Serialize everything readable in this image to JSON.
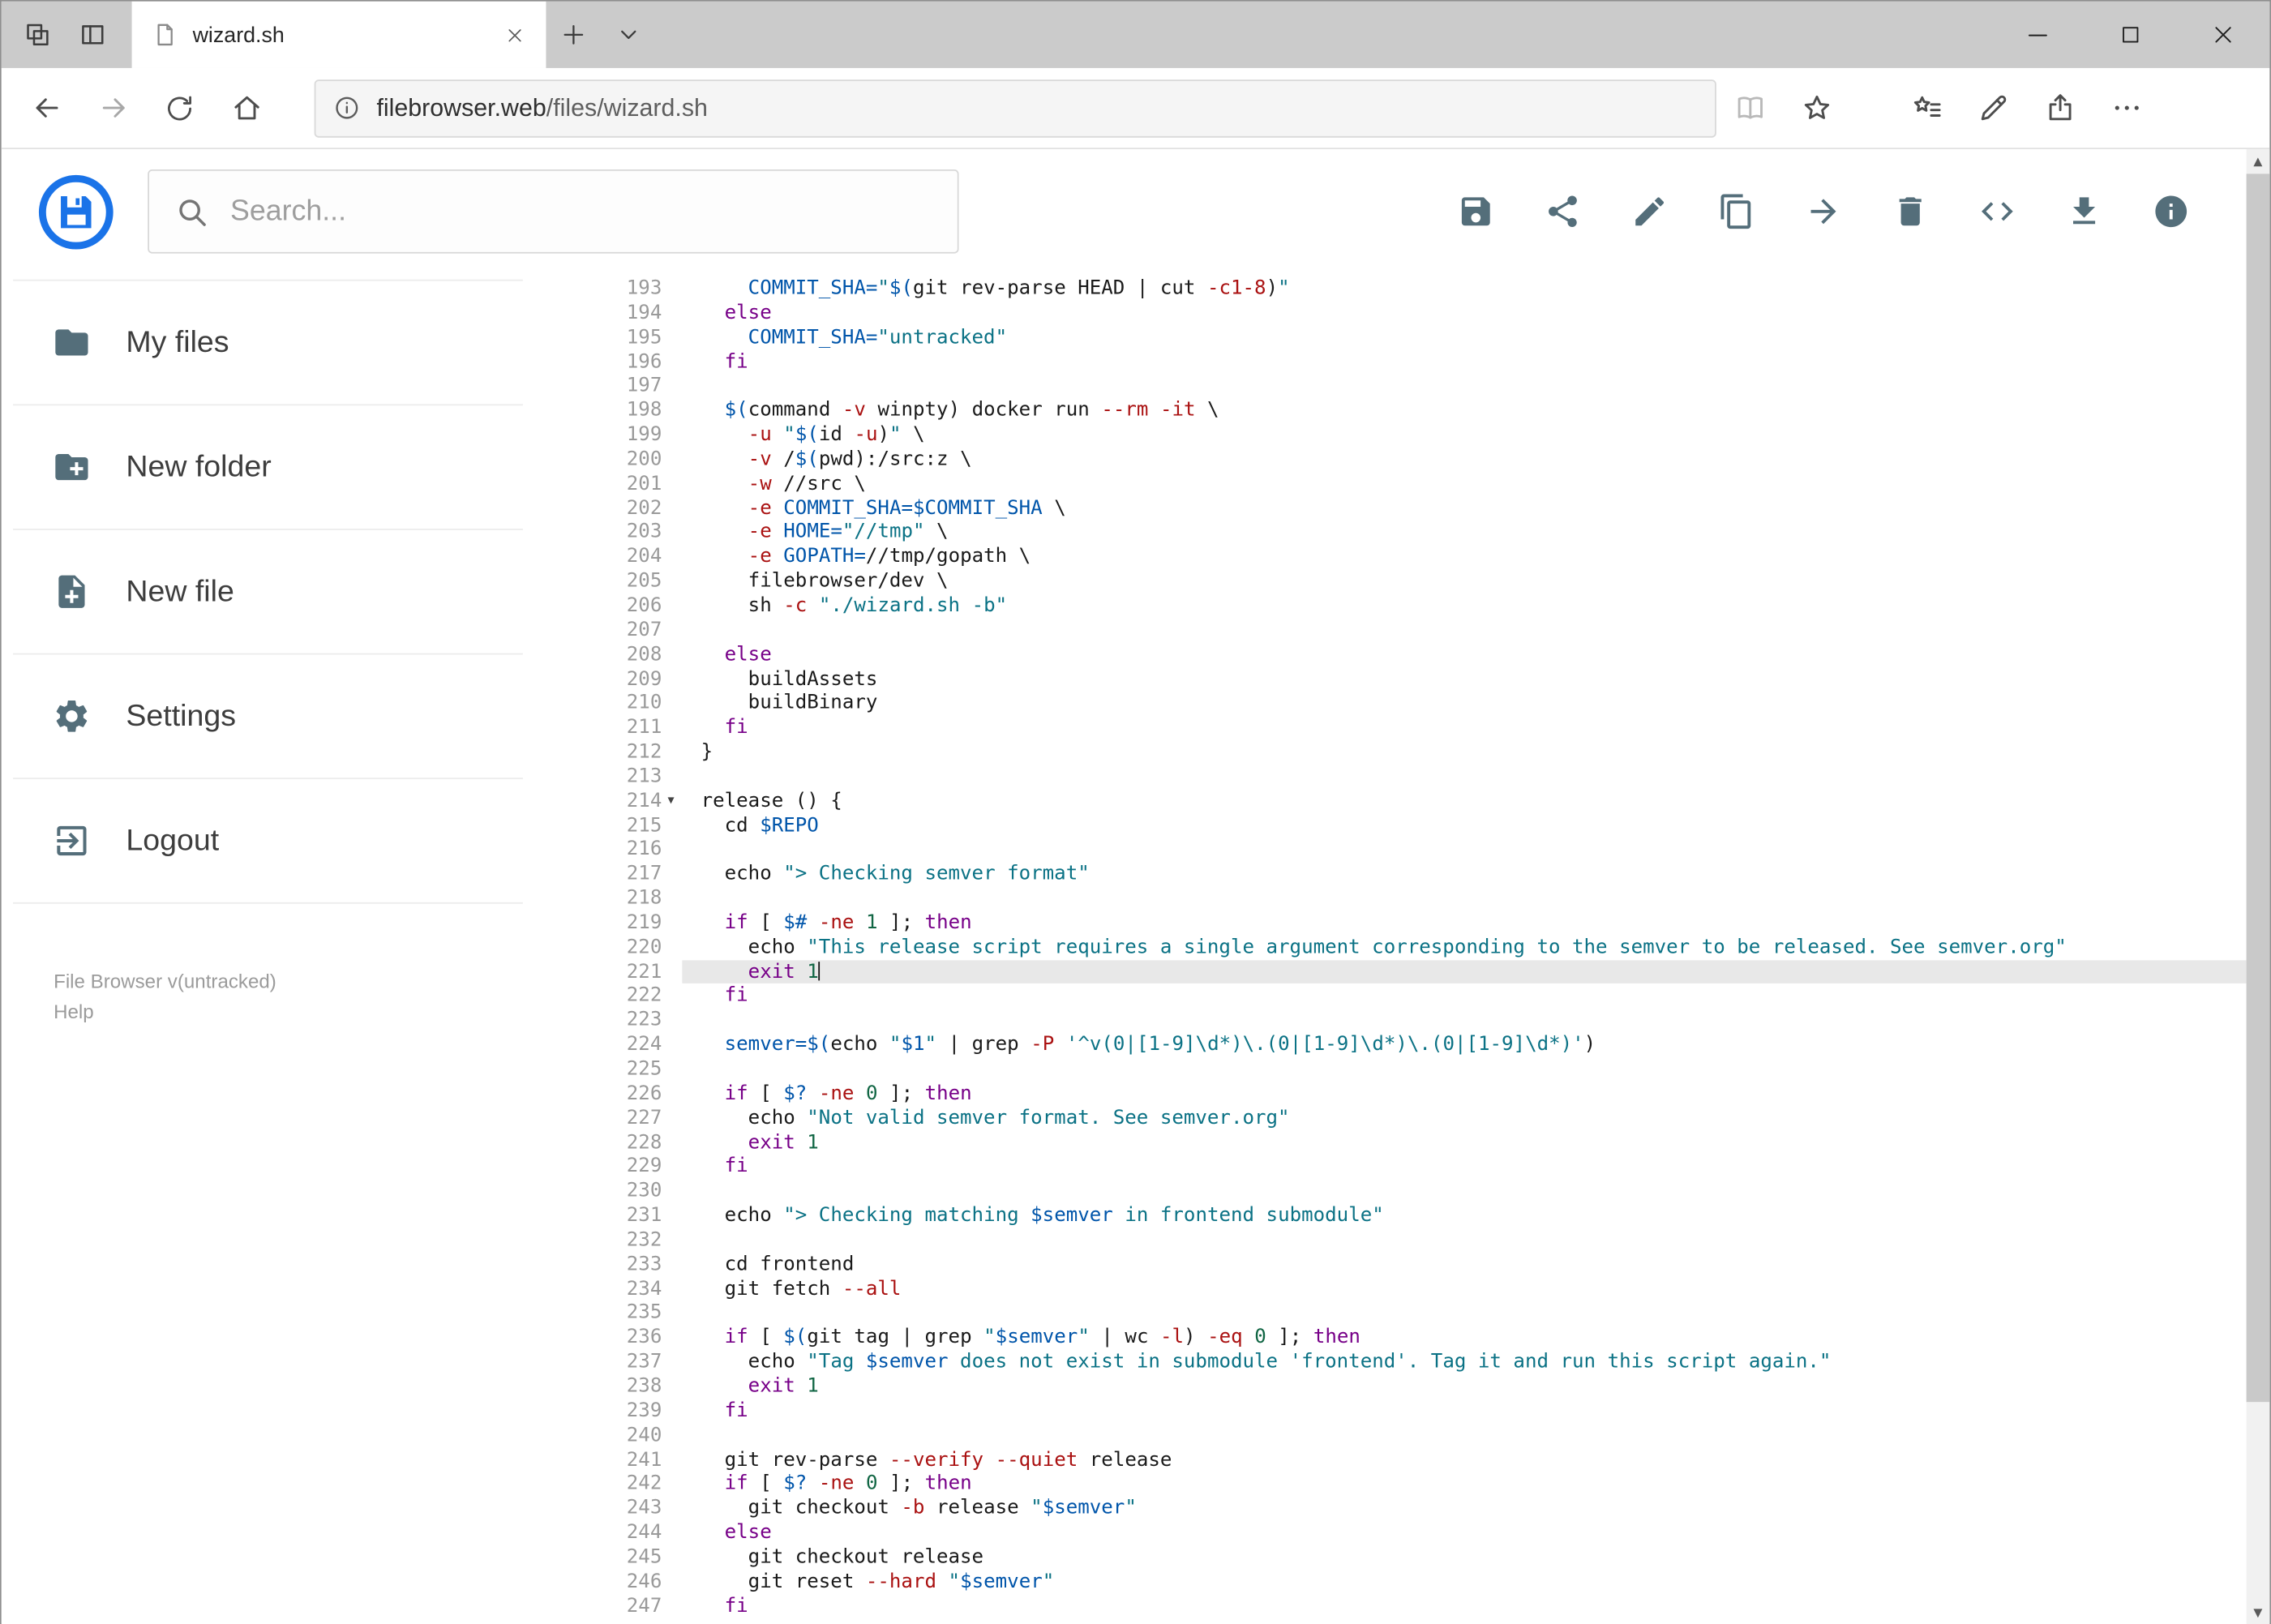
{
  "colors": {
    "accent_blue": "#1a73e8",
    "icon_gray": "#546e7a",
    "active_line_bg": "#e8e8e8",
    "code_keyword": "#770088",
    "code_string": "#0b7285",
    "code_variable": "#0055aa",
    "code_number": "#116644",
    "code_flag": "#aa1111"
  },
  "browser": {
    "tab_title": "wizard.sh",
    "url_domain": "filebrowser.web",
    "url_path": "/files/wizard.sh",
    "url_full": "filebrowser.web/files/wizard.sh"
  },
  "toolbar": {
    "search_placeholder": "Search...",
    "actions": [
      {
        "icon": "save"
      },
      {
        "icon": "share"
      },
      {
        "icon": "edit"
      },
      {
        "icon": "copy"
      },
      {
        "icon": "move"
      },
      {
        "icon": "delete"
      },
      {
        "icon": "code"
      },
      {
        "icon": "download"
      },
      {
        "icon": "info"
      }
    ]
  },
  "sidebar": {
    "items": [
      {
        "icon": "folder",
        "label": "My files"
      },
      {
        "icon": "new-folder",
        "label": "New folder"
      },
      {
        "icon": "new-file",
        "label": "New file"
      },
      {
        "icon": "settings",
        "label": "Settings"
      },
      {
        "icon": "logout",
        "label": "Logout"
      }
    ],
    "footer": {
      "version_label": "File Browser v(untracked)",
      "help_label": "Help"
    }
  },
  "editor": {
    "active_line": 221,
    "lines": [
      {
        "n": 193,
        "t": [
          [
            "pl",
            "    "
          ],
          [
            "vr",
            "COMMIT_SHA="
          ],
          [
            "st",
            "\""
          ],
          [
            "vr",
            "$("
          ],
          [
            "pl",
            "git rev-parse HEAD | cut "
          ],
          [
            "fl",
            "-c1-8"
          ],
          [
            "pl",
            ")"
          ],
          [
            "st",
            "\""
          ]
        ]
      },
      {
        "n": 194,
        "t": [
          [
            "pl",
            "  "
          ],
          [
            "kw",
            "else"
          ]
        ]
      },
      {
        "n": 195,
        "t": [
          [
            "pl",
            "    "
          ],
          [
            "vr",
            "COMMIT_SHA="
          ],
          [
            "st",
            "\"untracked\""
          ]
        ]
      },
      {
        "n": 196,
        "t": [
          [
            "pl",
            "  "
          ],
          [
            "kw",
            "fi"
          ]
        ]
      },
      {
        "n": 197,
        "t": []
      },
      {
        "n": 198,
        "t": [
          [
            "pl",
            "  "
          ],
          [
            "vr",
            "$("
          ],
          [
            "pl",
            "command "
          ],
          [
            "fl",
            "-v"
          ],
          [
            "pl",
            " winpty) docker run "
          ],
          [
            "fl",
            "--rm"
          ],
          [
            "pl",
            " "
          ],
          [
            "fl",
            "-it"
          ],
          [
            "pl",
            " \\"
          ]
        ]
      },
      {
        "n": 199,
        "t": [
          [
            "pl",
            "    "
          ],
          [
            "fl",
            "-u"
          ],
          [
            "pl",
            " "
          ],
          [
            "st",
            "\""
          ],
          [
            "vr",
            "$("
          ],
          [
            "pl",
            "id "
          ],
          [
            "fl",
            "-u"
          ],
          [
            "pl",
            ")"
          ],
          [
            "st",
            "\""
          ],
          [
            "pl",
            " \\"
          ]
        ]
      },
      {
        "n": 200,
        "t": [
          [
            "pl",
            "    "
          ],
          [
            "fl",
            "-v"
          ],
          [
            "pl",
            " /"
          ],
          [
            "vr",
            "$("
          ],
          [
            "pl",
            "pwd):/src:z \\"
          ]
        ]
      },
      {
        "n": 201,
        "t": [
          [
            "pl",
            "    "
          ],
          [
            "fl",
            "-w"
          ],
          [
            "pl",
            " //src \\"
          ]
        ]
      },
      {
        "n": 202,
        "t": [
          [
            "pl",
            "    "
          ],
          [
            "fl",
            "-e"
          ],
          [
            "pl",
            " "
          ],
          [
            "vr",
            "COMMIT_SHA=$COMMIT_SHA"
          ],
          [
            "pl",
            " \\"
          ]
        ]
      },
      {
        "n": 203,
        "t": [
          [
            "pl",
            "    "
          ],
          [
            "fl",
            "-e"
          ],
          [
            "pl",
            " "
          ],
          [
            "vr",
            "HOME="
          ],
          [
            "st",
            "\"//tmp\""
          ],
          [
            "pl",
            " \\"
          ]
        ]
      },
      {
        "n": 204,
        "t": [
          [
            "pl",
            "    "
          ],
          [
            "fl",
            "-e"
          ],
          [
            "pl",
            " "
          ],
          [
            "vr",
            "GOPATH="
          ],
          [
            "pl",
            "//tmp/gopath \\"
          ]
        ]
      },
      {
        "n": 205,
        "t": [
          [
            "pl",
            "    filebrowser/dev \\"
          ]
        ]
      },
      {
        "n": 206,
        "t": [
          [
            "pl",
            "    sh "
          ],
          [
            "fl",
            "-c"
          ],
          [
            "pl",
            " "
          ],
          [
            "st",
            "\"./wizard.sh -b\""
          ]
        ]
      },
      {
        "n": 207,
        "t": []
      },
      {
        "n": 208,
        "t": [
          [
            "pl",
            "  "
          ],
          [
            "kw",
            "else"
          ]
        ]
      },
      {
        "n": 209,
        "t": [
          [
            "pl",
            "    buildAssets"
          ]
        ]
      },
      {
        "n": 210,
        "t": [
          [
            "pl",
            "    buildBinary"
          ]
        ]
      },
      {
        "n": 211,
        "t": [
          [
            "pl",
            "  "
          ],
          [
            "kw",
            "fi"
          ]
        ]
      },
      {
        "n": 212,
        "t": [
          [
            "pl",
            "}"
          ]
        ]
      },
      {
        "n": 213,
        "t": []
      },
      {
        "n": 214,
        "fold": true,
        "t": [
          [
            "pl",
            "release () {"
          ]
        ]
      },
      {
        "n": 215,
        "t": [
          [
            "pl",
            "  cd "
          ],
          [
            "vr",
            "$REPO"
          ]
        ]
      },
      {
        "n": 216,
        "t": []
      },
      {
        "n": 217,
        "t": [
          [
            "pl",
            "  echo "
          ],
          [
            "st",
            "\"> Checking semver format\""
          ]
        ]
      },
      {
        "n": 218,
        "t": []
      },
      {
        "n": 219,
        "t": [
          [
            "pl",
            "  "
          ],
          [
            "kw",
            "if"
          ],
          [
            "pl",
            " [ "
          ],
          [
            "vr",
            "$#"
          ],
          [
            "pl",
            " "
          ],
          [
            "fl",
            "-ne"
          ],
          [
            "pl",
            " "
          ],
          [
            "nm",
            "1"
          ],
          [
            "pl",
            " ]; "
          ],
          [
            "kw",
            "then"
          ]
        ]
      },
      {
        "n": 220,
        "t": [
          [
            "pl",
            "    echo "
          ],
          [
            "st",
            "\"This release script requires a single argument corresponding to the semver to be released. See semver.org\""
          ]
        ]
      },
      {
        "n": 221,
        "active": true,
        "cursor": true,
        "t": [
          [
            "pl",
            "    "
          ],
          [
            "kw",
            "exit"
          ],
          [
            "pl",
            " "
          ],
          [
            "nm",
            "1"
          ]
        ]
      },
      {
        "n": 222,
        "t": [
          [
            "pl",
            "  "
          ],
          [
            "kw",
            "fi"
          ]
        ]
      },
      {
        "n": 223,
        "t": []
      },
      {
        "n": 224,
        "t": [
          [
            "pl",
            "  "
          ],
          [
            "vr",
            "semver=$("
          ],
          [
            "pl",
            "echo "
          ],
          [
            "st",
            "\""
          ],
          [
            "vr",
            "$1"
          ],
          [
            "st",
            "\""
          ],
          [
            "pl",
            " | grep "
          ],
          [
            "fl",
            "-P"
          ],
          [
            "pl",
            " "
          ],
          [
            "st",
            "'^v(0|[1-9]\\d*)\\.(0|[1-9]\\d*)\\.(0|[1-9]\\d*)'"
          ],
          [
            "pl",
            ")"
          ]
        ]
      },
      {
        "n": 225,
        "t": []
      },
      {
        "n": 226,
        "t": [
          [
            "pl",
            "  "
          ],
          [
            "kw",
            "if"
          ],
          [
            "pl",
            " [ "
          ],
          [
            "vr",
            "$?"
          ],
          [
            "pl",
            " "
          ],
          [
            "fl",
            "-ne"
          ],
          [
            "pl",
            " "
          ],
          [
            "nm",
            "0"
          ],
          [
            "pl",
            " ]; "
          ],
          [
            "kw",
            "then"
          ]
        ]
      },
      {
        "n": 227,
        "t": [
          [
            "pl",
            "    echo "
          ],
          [
            "st",
            "\"Not valid semver format. See semver.org\""
          ]
        ]
      },
      {
        "n": 228,
        "t": [
          [
            "pl",
            "    "
          ],
          [
            "kw",
            "exit"
          ],
          [
            "pl",
            " "
          ],
          [
            "nm",
            "1"
          ]
        ]
      },
      {
        "n": 229,
        "t": [
          [
            "pl",
            "  "
          ],
          [
            "kw",
            "fi"
          ]
        ]
      },
      {
        "n": 230,
        "t": []
      },
      {
        "n": 231,
        "t": [
          [
            "pl",
            "  echo "
          ],
          [
            "st",
            "\"> Checking matching "
          ],
          [
            "vr",
            "$semver"
          ],
          [
            "st",
            " in frontend submodule\""
          ]
        ]
      },
      {
        "n": 232,
        "t": []
      },
      {
        "n": 233,
        "t": [
          [
            "pl",
            "  cd frontend"
          ]
        ]
      },
      {
        "n": 234,
        "t": [
          [
            "pl",
            "  git fetch "
          ],
          [
            "fl",
            "--all"
          ]
        ]
      },
      {
        "n": 235,
        "t": []
      },
      {
        "n": 236,
        "t": [
          [
            "pl",
            "  "
          ],
          [
            "kw",
            "if"
          ],
          [
            "pl",
            " [ "
          ],
          [
            "vr",
            "$("
          ],
          [
            "pl",
            "git tag | grep "
          ],
          [
            "st",
            "\""
          ],
          [
            "vr",
            "$semver"
          ],
          [
            "st",
            "\""
          ],
          [
            "pl",
            " | wc "
          ],
          [
            "fl",
            "-l"
          ],
          [
            "pl",
            ") "
          ],
          [
            "fl",
            "-eq"
          ],
          [
            "pl",
            " "
          ],
          [
            "nm",
            "0"
          ],
          [
            "pl",
            " ]; "
          ],
          [
            "kw",
            "then"
          ]
        ]
      },
      {
        "n": 237,
        "t": [
          [
            "pl",
            "    echo "
          ],
          [
            "st",
            "\"Tag "
          ],
          [
            "vr",
            "$semver"
          ],
          [
            "st",
            " does not exist in submodule 'frontend'. Tag it and run this script again.\""
          ]
        ]
      },
      {
        "n": 238,
        "t": [
          [
            "pl",
            "    "
          ],
          [
            "kw",
            "exit"
          ],
          [
            "pl",
            " "
          ],
          [
            "nm",
            "1"
          ]
        ]
      },
      {
        "n": 239,
        "t": [
          [
            "pl",
            "  "
          ],
          [
            "kw",
            "fi"
          ]
        ]
      },
      {
        "n": 240,
        "t": []
      },
      {
        "n": 241,
        "t": [
          [
            "pl",
            "  git rev-parse "
          ],
          [
            "fl",
            "--verify"
          ],
          [
            "pl",
            " "
          ],
          [
            "fl",
            "--quiet"
          ],
          [
            "pl",
            " release"
          ]
        ]
      },
      {
        "n": 242,
        "t": [
          [
            "pl",
            "  "
          ],
          [
            "kw",
            "if"
          ],
          [
            "pl",
            " [ "
          ],
          [
            "vr",
            "$?"
          ],
          [
            "pl",
            " "
          ],
          [
            "fl",
            "-ne"
          ],
          [
            "pl",
            " "
          ],
          [
            "nm",
            "0"
          ],
          [
            "pl",
            " ]; "
          ],
          [
            "kw",
            "then"
          ]
        ]
      },
      {
        "n": 243,
        "t": [
          [
            "pl",
            "    git checkout "
          ],
          [
            "fl",
            "-b"
          ],
          [
            "pl",
            " release "
          ],
          [
            "st",
            "\""
          ],
          [
            "vr",
            "$semver"
          ],
          [
            "st",
            "\""
          ]
        ]
      },
      {
        "n": 244,
        "t": [
          [
            "pl",
            "  "
          ],
          [
            "kw",
            "else"
          ]
        ]
      },
      {
        "n": 245,
        "t": [
          [
            "pl",
            "    git checkout release"
          ]
        ]
      },
      {
        "n": 246,
        "t": [
          [
            "pl",
            "    git reset "
          ],
          [
            "fl",
            "--hard"
          ],
          [
            "pl",
            " "
          ],
          [
            "st",
            "\""
          ],
          [
            "vr",
            "$semver"
          ],
          [
            "st",
            "\""
          ]
        ]
      },
      {
        "n": 247,
        "t": [
          [
            "pl",
            "  "
          ],
          [
            "kw",
            "fi"
          ]
        ]
      }
    ]
  }
}
